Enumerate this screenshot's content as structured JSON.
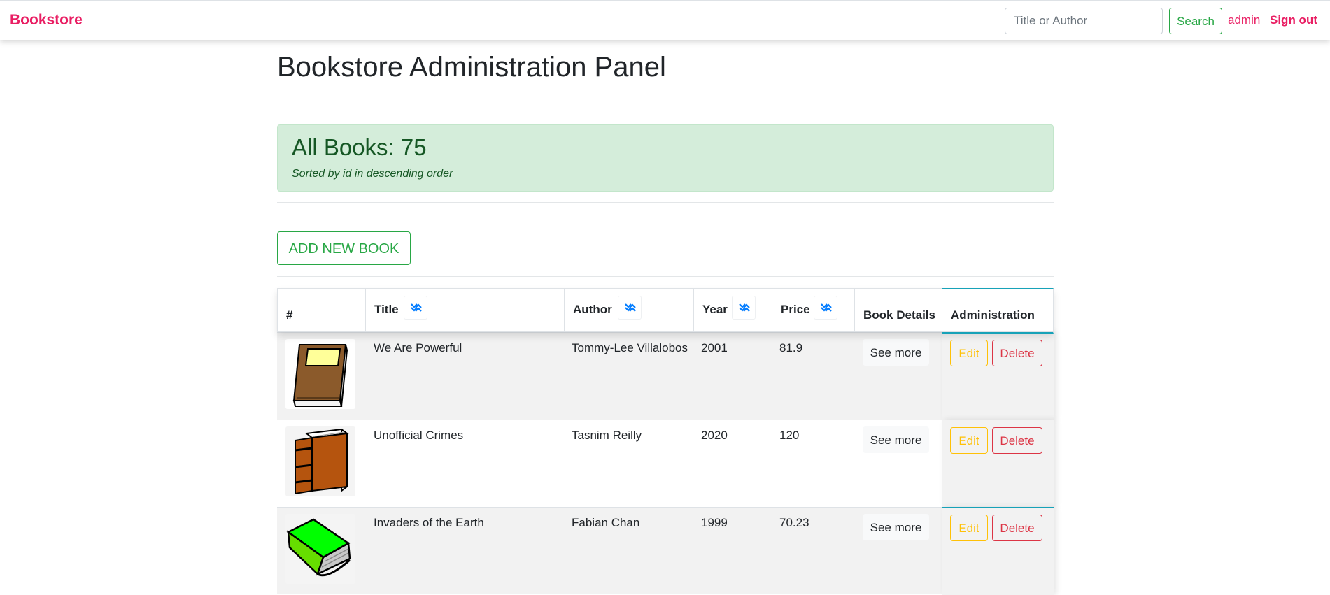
{
  "navbar": {
    "brand": "Bookstore",
    "search_placeholder": "Title or Author",
    "search_value": "",
    "search_button": "Search",
    "user": "admin",
    "sign_out": "Sign out"
  },
  "page": {
    "title": "Bookstore Administration Panel"
  },
  "summary": {
    "heading": "All Books: 75",
    "sort_note": "Sorted by id in descending order"
  },
  "actions": {
    "add_new_book": "ADD NEW BOOK"
  },
  "table": {
    "headers": {
      "index": "#",
      "title": "Title",
      "author": "Author",
      "year": "Year",
      "price": "Price",
      "details": "Book Details",
      "administration": "Administration"
    },
    "sort_icon": "double-chevron-up-down-icon",
    "rows": [
      {
        "cover_icon": "brown-book-with-label-icon",
        "title": "We Are Powerful",
        "author": "Tommy-Lee Villalobos",
        "year": "2001",
        "price": "81.9",
        "see_more": "See more",
        "edit": "Edit",
        "delete": "Delete"
      },
      {
        "cover_icon": "orange-hardcover-book-icon",
        "title": "Unofficial Crimes",
        "author": "Tasnim Reilly",
        "year": "2020",
        "price": "120",
        "see_more": "See more",
        "edit": "Edit",
        "delete": "Delete"
      },
      {
        "cover_icon": "green-book-icon",
        "title": "Invaders of the Earth",
        "author": "Fabian Chan",
        "year": "1999",
        "price": "70.23",
        "see_more": "See more",
        "edit": "Edit",
        "delete": "Delete"
      }
    ]
  },
  "colors": {
    "brand": "#e91e63",
    "success": "#28a745",
    "warning": "#ffc107",
    "danger": "#dc3545",
    "info": "#17a2b8",
    "alert_bg": "#d4edda",
    "sort_icon": "#007bff"
  }
}
